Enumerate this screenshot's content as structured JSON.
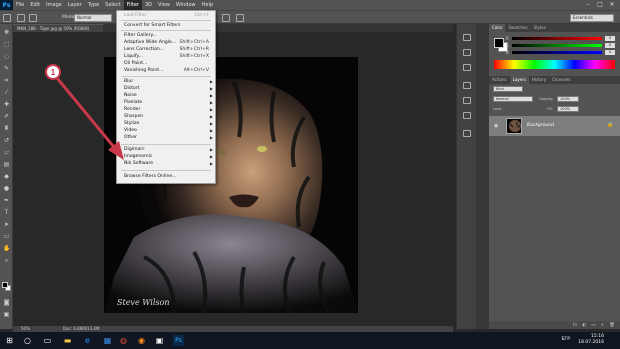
{
  "app": {
    "logo": "Ps",
    "menus": [
      "File",
      "Edit",
      "Image",
      "Layer",
      "Type",
      "Select",
      "Filter",
      "3D",
      "View",
      "Window",
      "Help"
    ],
    "active_menu": "Filter",
    "window_controls": [
      "–",
      "□",
      "✕"
    ]
  },
  "options": {
    "mode_label": "Mode:",
    "mode_value": "Normal",
    "workspace": "Essentials"
  },
  "document": {
    "tab_title": "MKN_188 - Tiger.jpg @ 50% (RGB/8)",
    "zoom": "50%",
    "doc_size": "Doc: 6.86M/13.4M",
    "watermark": "Steve Wilson"
  },
  "filter_menu": {
    "items": [
      {
        "label": "Last Filter",
        "shortcut": "Ctrl+F",
        "disabled": true
      },
      {
        "label": "Convert for Smart Filters",
        "shortcut": "",
        "disabled": false
      },
      {
        "label": "Filter Gallery...",
        "shortcut": "",
        "disabled": false
      },
      {
        "label": "Adaptive Wide Angle...",
        "shortcut": "Shift+Ctrl+A",
        "disabled": false
      },
      {
        "label": "Lens Correction...",
        "shortcut": "Shift+Ctrl+R",
        "disabled": false
      },
      {
        "label": "Liquify...",
        "shortcut": "Shift+Ctrl+X",
        "disabled": false
      },
      {
        "label": "Oil Paint...",
        "shortcut": "",
        "disabled": false
      },
      {
        "label": "Vanishing Point...",
        "shortcut": "Alt+Ctrl+V",
        "disabled": false
      },
      {
        "label": "Blur",
        "sub": true
      },
      {
        "label": "Distort",
        "sub": true
      },
      {
        "label": "Noise",
        "sub": true
      },
      {
        "label": "Pixelate",
        "sub": true
      },
      {
        "label": "Render",
        "sub": true
      },
      {
        "label": "Sharpen",
        "sub": true
      },
      {
        "label": "Stylize",
        "sub": true
      },
      {
        "label": "Video",
        "sub": true
      },
      {
        "label": "Other",
        "sub": true
      },
      {
        "label": "Digimarc",
        "sub": true
      },
      {
        "label": "Imagenomic",
        "sub": true
      },
      {
        "label": "Nik Software",
        "sub": true
      },
      {
        "label": "Browse Filters Online...",
        "sub": false
      }
    ]
  },
  "annotation": {
    "callout_number": "1"
  },
  "panels": {
    "color_tabs": [
      "Color",
      "Swatches",
      "Styles"
    ],
    "sliders": [
      {
        "label": "R",
        "value": "0"
      },
      {
        "label": "G",
        "value": "0"
      },
      {
        "label": "B",
        "value": "0"
      }
    ],
    "layer_tabs": [
      "Actions",
      "Layers",
      "History",
      "Channels"
    ],
    "blend_mode": "Normal",
    "opacity_label": "Opacity:",
    "opacity_value": "100%",
    "fill_label": "Fill:",
    "fill_value": "100%",
    "kind": "Kind",
    "lock_label": "Lock:",
    "layer_name": "Background",
    "bottom_icons": [
      "fx",
      "◐",
      "▭",
      "+",
      "🗑"
    ]
  },
  "taskbar": {
    "lang": "БГР",
    "time": "15:16",
    "date": "18.07.2016",
    "locale_line": "BGPT"
  },
  "colors": {
    "menu_bg": "#535353",
    "canvas_bg": "#282828",
    "arrow": "#c7394a",
    "taskbar": "#101621"
  }
}
